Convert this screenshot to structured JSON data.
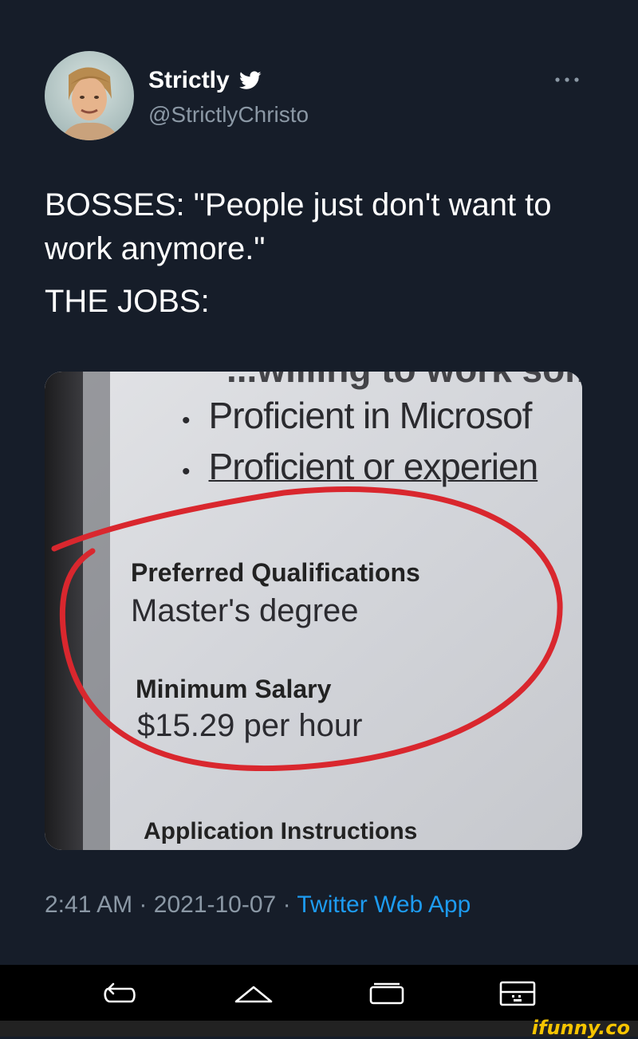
{
  "author": {
    "display_name": "Strictly",
    "handle": "@StrictlyChristo",
    "verified_icon": "twitter-bird-icon"
  },
  "more_icon": "more-horizontal-icon",
  "tweet": {
    "line1": "BOSSES: \"People just don't want to work anymore.\"",
    "line2": "THE JOBS:"
  },
  "media": {
    "cut_off_top": "...willing to work some...",
    "bullets": [
      "Proficient in Microsof",
      "Proficient or experien"
    ],
    "preferred_label": "Preferred Qualifications",
    "preferred_value": "Master's degree",
    "salary_label": "Minimum Salary",
    "salary_value": "$15.29 per hour",
    "instructions_label": "Application Instructions",
    "highlight_color": "#d9272e"
  },
  "meta": {
    "time": "2:41 AM",
    "separator": "·",
    "date": "2021-10-07",
    "source": "Twitter Web App"
  },
  "navbar": {
    "icons": [
      "back-icon",
      "home-icon",
      "recent-apps-icon",
      "keyboard-icon"
    ]
  },
  "watermark": "ifunny.co"
}
